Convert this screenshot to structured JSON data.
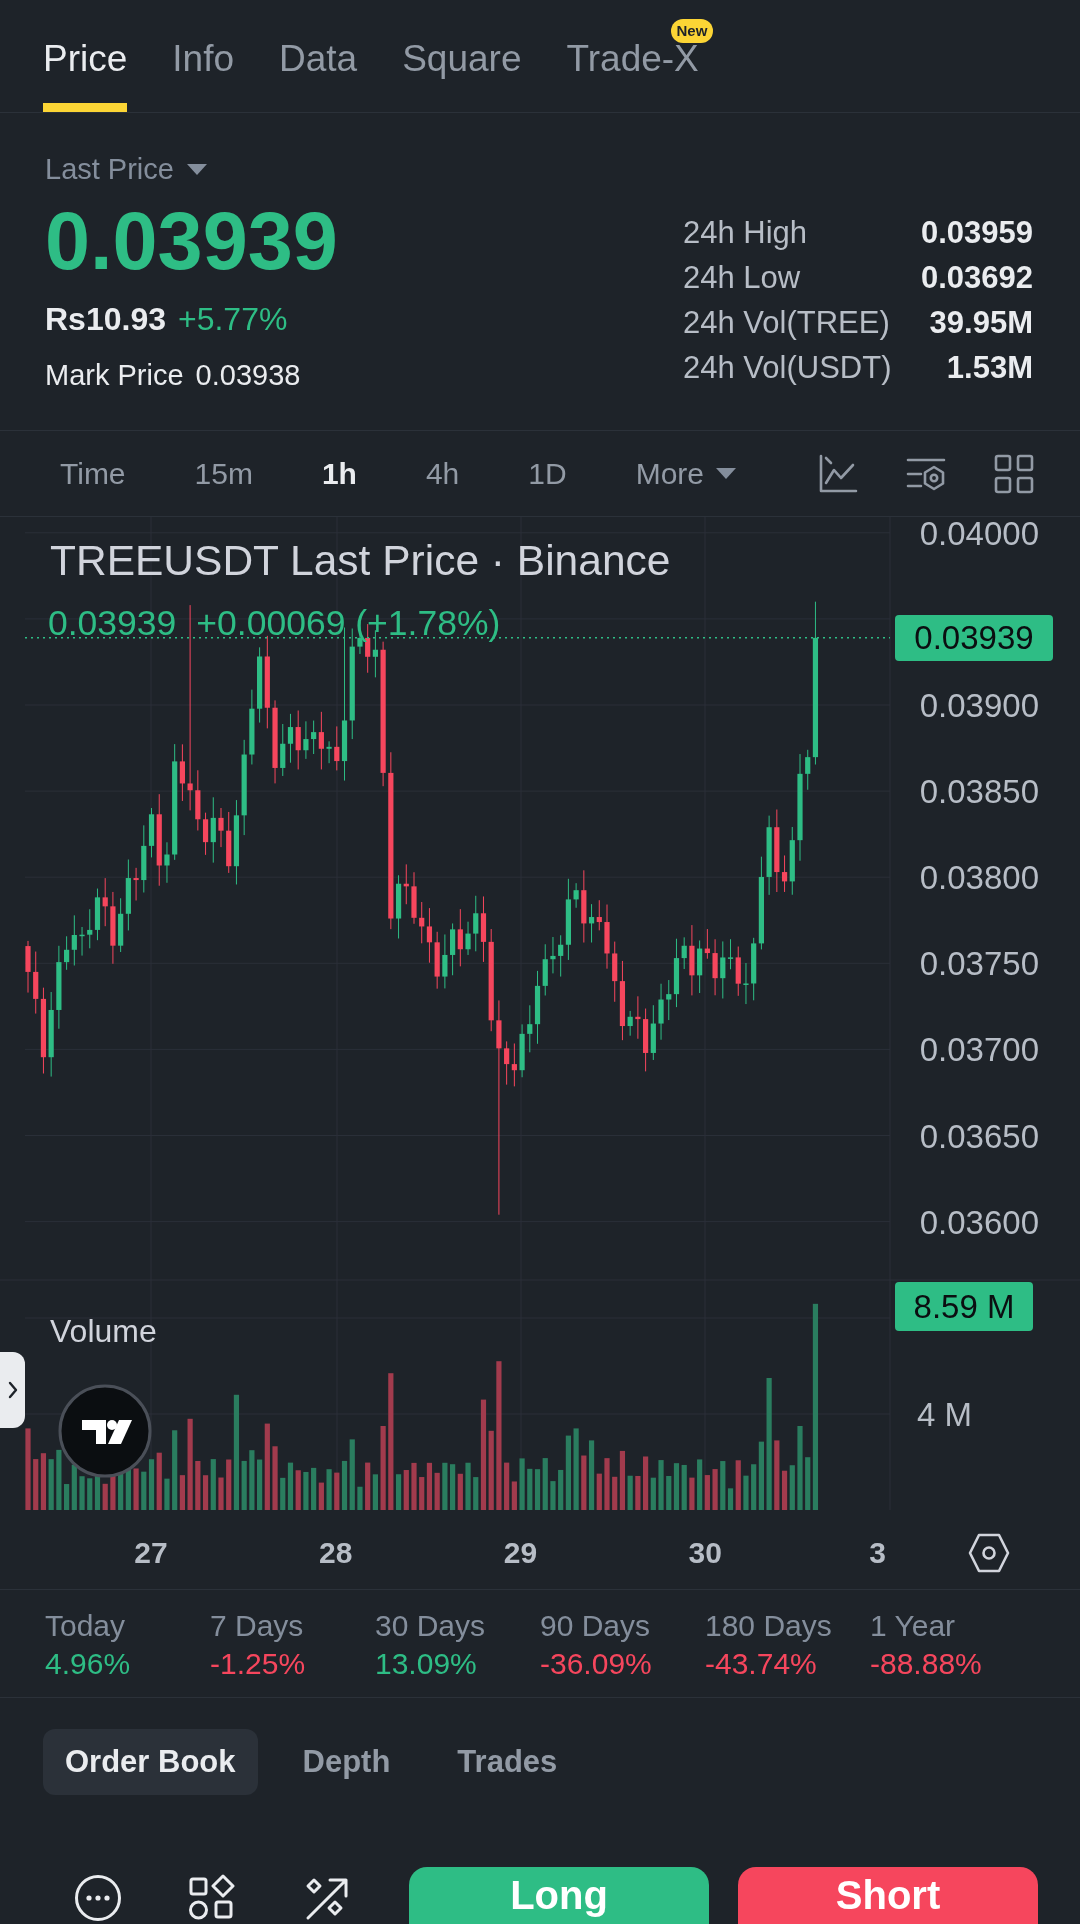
{
  "tabs": [
    {
      "label": "Price",
      "selected": true
    },
    {
      "label": "Info",
      "selected": false
    },
    {
      "label": "Data",
      "selected": false
    },
    {
      "label": "Square",
      "selected": false
    },
    {
      "label": "Trade-X",
      "selected": false,
      "badge": "New"
    }
  ],
  "summary": {
    "price_type": "Last Price",
    "last_price": "0.03939",
    "local_price": "Rs10.93",
    "change": "+5.77%",
    "mark_price_label": "Mark Price",
    "mark_price": "0.03938",
    "stats": [
      {
        "label": "24h High",
        "value": "0.03959"
      },
      {
        "label": "24h Low",
        "value": "0.03692"
      },
      {
        "label": "24h Vol(TREE)",
        "value": "39.95M"
      },
      {
        "label": "24h Vol(USDT)",
        "value": "1.53M"
      }
    ]
  },
  "intervals": [
    {
      "label": "Time",
      "kind": "interval",
      "selected": false
    },
    {
      "label": "15m",
      "kind": "interval",
      "selected": false
    },
    {
      "label": "1h",
      "kind": "interval",
      "selected": true
    },
    {
      "label": "4h",
      "kind": "interval",
      "selected": false
    },
    {
      "label": "1D",
      "kind": "interval",
      "selected": false
    },
    {
      "label": "More",
      "kind": "menu",
      "selected": false
    }
  ],
  "chart": {
    "title": "TREEUSDT Last Price · Binance",
    "last_price": "0.03939",
    "change": "+0.00069 (+1.78%)",
    "price_tag": "0.03939",
    "price_axis": [
      "0.04000",
      "0.03900",
      "0.03850",
      "0.03800",
      "0.03750",
      "0.03700",
      "0.03650",
      "0.03600"
    ],
    "time_axis": [
      "27",
      "28",
      "29",
      "30",
      "3"
    ],
    "volume_title": "Volume",
    "volume_tag": "8.59 M",
    "volume_axis": [
      "4 M"
    ]
  },
  "performance": [
    {
      "period": "Today",
      "change": "4.96%",
      "color": "#2ebd85"
    },
    {
      "period": "7 Days",
      "change": "-1.25%",
      "color": "#f6465d"
    },
    {
      "period": "30 Days",
      "change": "13.09%",
      "color": "#2ebd85"
    },
    {
      "period": "90 Days",
      "change": "-36.09%",
      "color": "#f6465d"
    },
    {
      "period": "180 Days",
      "change": "-43.74%",
      "color": "#f6465d"
    },
    {
      "period": "1 Year",
      "change": "-88.88%",
      "color": "#f6465d"
    }
  ],
  "book_tabs": [
    {
      "label": "Order Book",
      "selected": true
    },
    {
      "label": "Depth",
      "selected": false
    },
    {
      "label": "Trades",
      "selected": false
    }
  ],
  "actions": [
    {
      "label": "Long",
      "color": "#2ebd85"
    },
    {
      "label": "Short",
      "color": "#f6465d"
    }
  ]
}
